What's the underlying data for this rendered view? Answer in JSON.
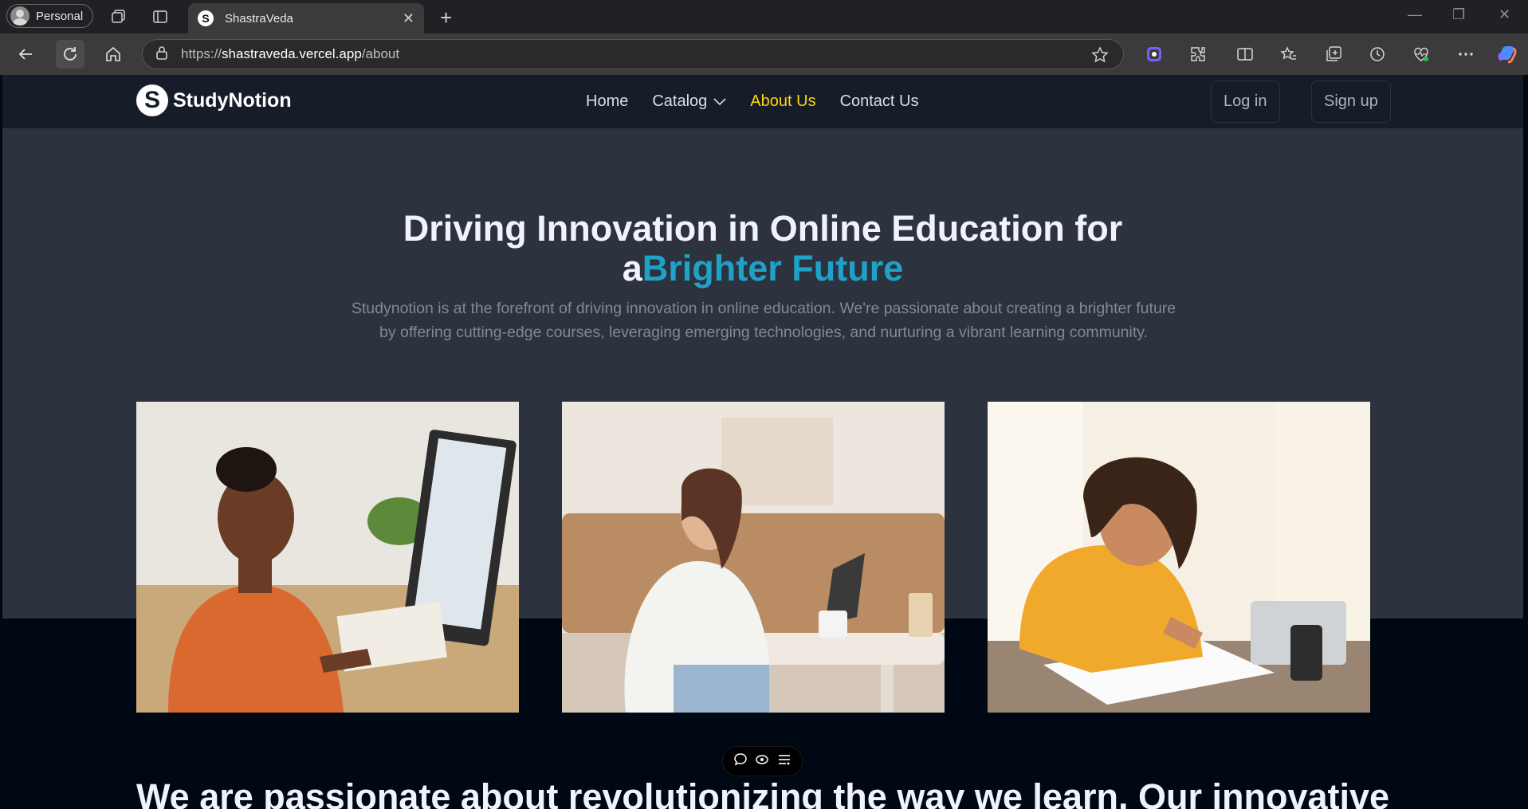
{
  "browser": {
    "profile_label": "Personal",
    "tab_title": "ShastraVeda",
    "tab_favicon": "S",
    "url_scheme": "https://",
    "url_host": "shastraveda.vercel.app",
    "url_path": "/about"
  },
  "site": {
    "logo_mark": "S",
    "logo_text": "StudyNotion",
    "nav": {
      "home": "Home",
      "catalog": "Catalog",
      "about": "About Us",
      "contact": "Contact Us"
    },
    "login_label": "Log in",
    "signup_label": "Sign up"
  },
  "hero": {
    "heading_line1": "Driving Innovation in Online Education for",
    "heading_prefix": "a",
    "heading_highlight": "Brighter Future",
    "description": "Studynotion is at the forefront of driving innovation in online education. We're passionate about creating a brighter future by offering cutting-edge courses, leveraging emerging technologies, and nurturing a vibrant learning community."
  },
  "mission": {
    "text": "We are passionate about revolutionizing the way we learn. Our innovative"
  },
  "colors": {
    "accent_yellow": "#FFD60A",
    "highlight_blue": "#1FA2C7",
    "nav_bg": "#161D29",
    "hero_bg": "#2C333F",
    "page_bg": "#000814"
  }
}
